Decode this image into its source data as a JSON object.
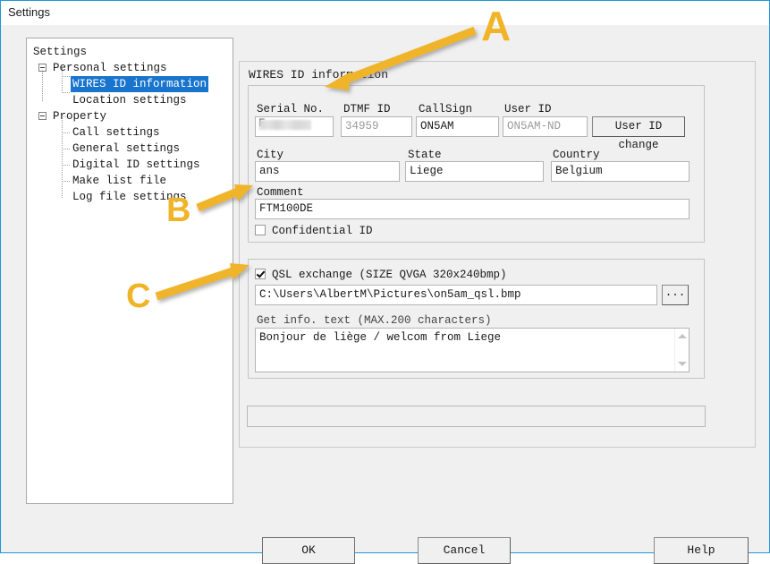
{
  "window": {
    "title": "Settings",
    "accent_color": "#2196d9"
  },
  "tree": {
    "root_label": "Settings",
    "nodes": [
      {
        "label": "Settings",
        "level": 0,
        "expander": false,
        "selected": false
      },
      {
        "label": "Personal settings",
        "level": 1,
        "expander": true,
        "selected": false
      },
      {
        "label": "WIRES ID information",
        "level": 2,
        "expander": false,
        "selected": true
      },
      {
        "label": "Location settings",
        "level": 2,
        "expander": false,
        "selected": false
      },
      {
        "label": "Property",
        "level": 1,
        "expander": true,
        "selected": false
      },
      {
        "label": "Call settings",
        "level": 2,
        "expander": false,
        "selected": false
      },
      {
        "label": "General settings",
        "level": 2,
        "expander": false,
        "selected": false
      },
      {
        "label": "Digital ID settings",
        "level": 2,
        "expander": false,
        "selected": false
      },
      {
        "label": "Make list file",
        "level": 2,
        "expander": false,
        "selected": false
      },
      {
        "label": "Log file settings",
        "level": 2,
        "expander": false,
        "selected": false
      }
    ],
    "selection_color": "#1874cd"
  },
  "panel": {
    "title": "WIRES ID information"
  },
  "id_group": {
    "serial_no": {
      "label": "Serial No.",
      "value": "",
      "redacted": true,
      "redacted_prefix": "F"
    },
    "dtmf_id": {
      "label": "DTMF ID",
      "value": "34959",
      "disabled": true
    },
    "callsign": {
      "label": "CallSign",
      "value": "ON5AM",
      "disabled": false
    },
    "user_id": {
      "label": "User ID",
      "value": "ON5AM-ND",
      "disabled": true
    },
    "user_id_change_button": "User ID change",
    "city": {
      "label": "City",
      "value": "ans"
    },
    "state": {
      "label": "State",
      "value": "Liege"
    },
    "country": {
      "label": "Country",
      "value": "Belgium"
    },
    "comment": {
      "label": "Comment",
      "value": "FTM100DE"
    },
    "confidential_id": {
      "label": "Confidential ID",
      "checked": false
    }
  },
  "qsl_group": {
    "qsl_exchange": {
      "label": "QSL exchange  (SIZE QVGA 320x240bmp)",
      "checked": true
    },
    "image_path": {
      "value": "C:\\Users\\AlbertM\\Pictures\\on5am_qsl.bmp"
    },
    "browse_button": "...",
    "get_info_text": {
      "label": "Get info. text (MAX.200 characters)",
      "value": "Bonjour de liège / welcom from Liege"
    }
  },
  "bottom_field": {
    "value": ""
  },
  "buttons": {
    "ok": "OK",
    "cancel": "Cancel",
    "help": "Help"
  },
  "annotations": {
    "arrow_color": "#f0b429",
    "items": [
      {
        "letter": "A",
        "target": "serial-no-field"
      },
      {
        "letter": "B",
        "target": "comment-field"
      },
      {
        "letter": "C",
        "target": "qsl-image-path-field"
      }
    ]
  }
}
